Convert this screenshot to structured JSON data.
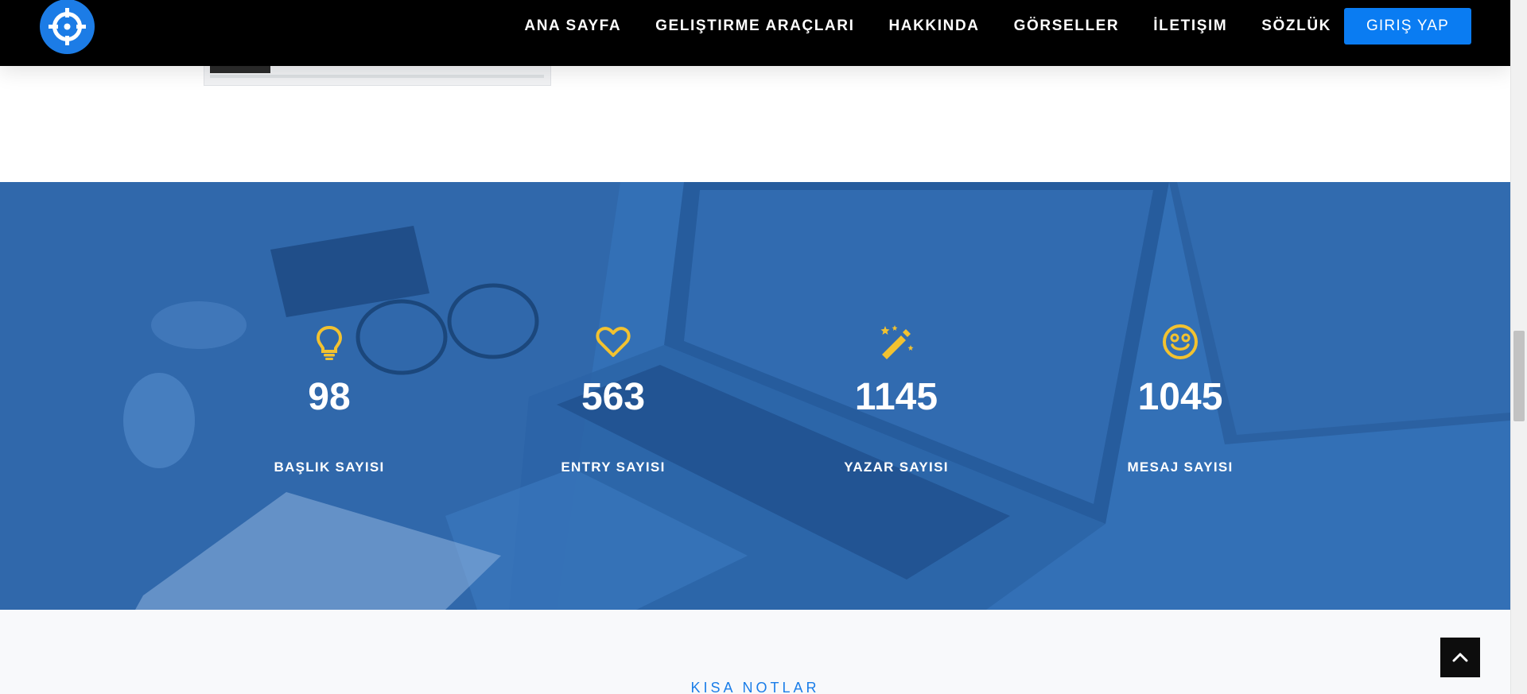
{
  "navbar": {
    "logo_icon": "crosshair-logo-icon",
    "links": [
      {
        "label": "ANA SAYFA"
      },
      {
        "label": "GELIŞTIRME ARAÇLARI"
      },
      {
        "label": "HAKKINDA"
      },
      {
        "label": "GÖRSELLER"
      },
      {
        "label": "İLETIŞIM"
      },
      {
        "label": "SÖZLÜK"
      }
    ],
    "login_label": "GIRIŞ YAP"
  },
  "stats": {
    "items": [
      {
        "icon": "lightbulb-icon",
        "number": "98",
        "label": "BAŞLIK SAYISI"
      },
      {
        "icon": "heart-icon",
        "number": "563",
        "label": "ENTRY SAYISI"
      },
      {
        "icon": "magic-wand-icon",
        "number": "1145",
        "label": "YAZAR SAYISI"
      },
      {
        "icon": "smiley-icon",
        "number": "1045",
        "label": "MESAJ SAYISI"
      }
    ]
  },
  "notes": {
    "subtitle": "KISA NOTLAR"
  },
  "back_to_top_icon": "chevron-up-icon",
  "colors": {
    "accent_blue": "#0a7cf2",
    "stats_overlay": "#2f6cb2",
    "icon_yellow": "#f2c230",
    "navbar_bg": "#000000"
  }
}
